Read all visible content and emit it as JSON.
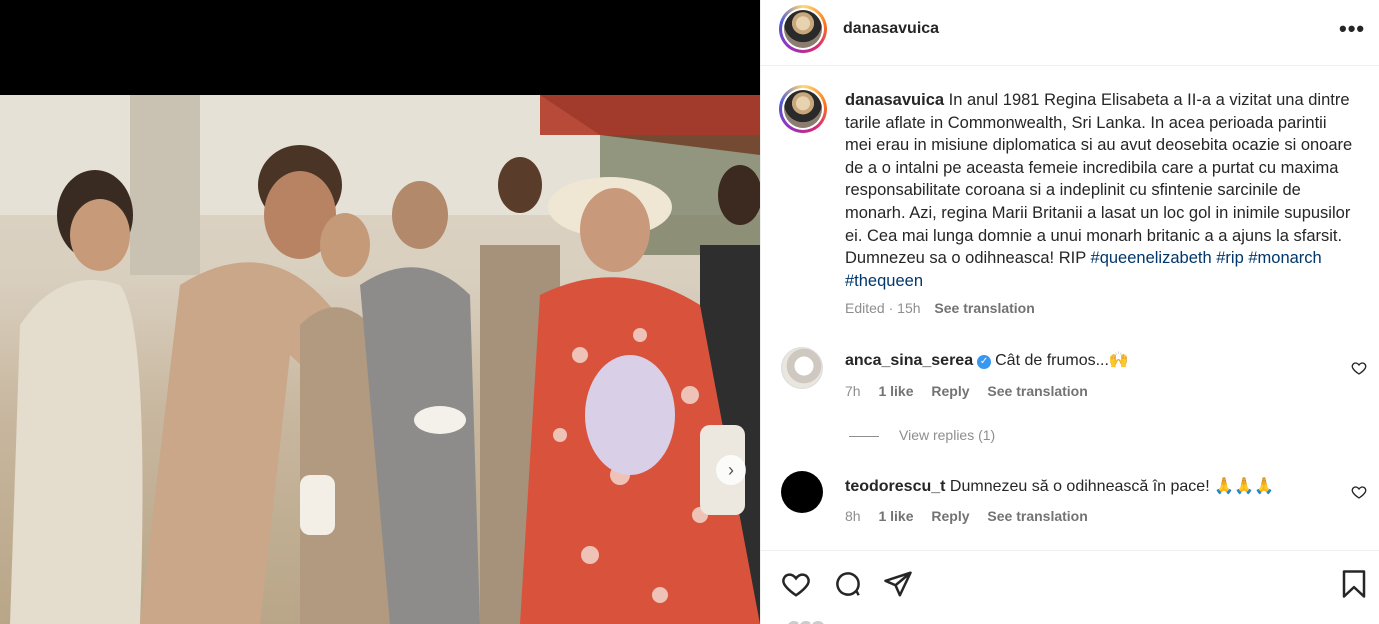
{
  "header": {
    "username": "danasavuica",
    "more_icon": "more-icon",
    "more_label": "•••"
  },
  "caption": {
    "username": "danasavuica",
    "text": "In anul 1981 Regina Elisabeta a II-a a vizitat una dintre tarile aflate in Commonwealth, Sri Lanka. In acea perioada parintii mei erau in misiune diplomatica si au avut deosebita ocazie si onoare de a o intalni pe aceasta femeie incredibila care a purtat cu maxima responsabilitate coroana si a indeplinit cu sfintenie sarcinile de monarh. Azi, regina Marii Britanii a lasat un loc gol in inimile supusilor ei. Cea mai lunga domnie a unui monarh britanic a a ajuns la sfarsit. Dumnezeu sa o odihneasca! RIP",
    "hashtags": [
      "#queenelizabeth",
      "#rip",
      "#monarch",
      "#thequeen"
    ],
    "edited": "Edited",
    "time": "15h",
    "see_translation": "See translation"
  },
  "comments": [
    {
      "username": "anca_sina_serea",
      "verified": true,
      "text": "Cât de frumos...🙌",
      "time": "7h",
      "likes": "1 like",
      "reply": "Reply",
      "see_translation": "See translation",
      "view_replies": "View replies (1)"
    },
    {
      "username": "teodorescu_t",
      "text": "Dumnezeu să o odihnească în pace! 🙏🙏🙏",
      "time": "8h",
      "likes": "1 like",
      "reply": "Reply",
      "see_translation": "See translation"
    }
  ],
  "actions": {
    "like_icon": "heart-icon",
    "comment_icon": "comment-icon",
    "share_icon": "share-icon",
    "save_icon": "bookmark-icon"
  },
  "media": {
    "next_icon": "chevron-right-icon",
    "next_label": "›"
  }
}
